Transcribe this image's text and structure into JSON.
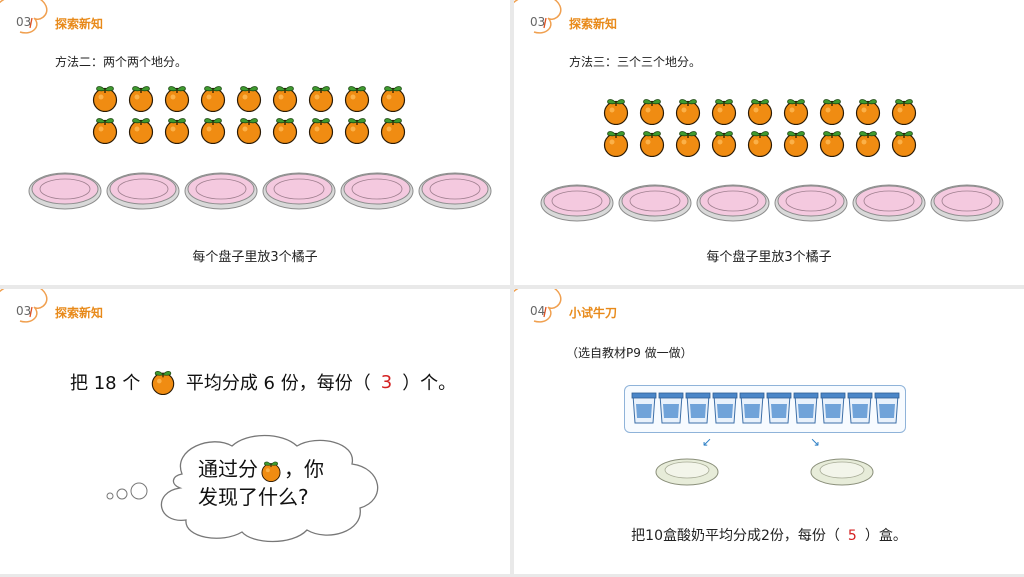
{
  "panels": [
    {
      "num": "03",
      "title": "探索新知",
      "subtitle": "方法二：两个两个地分。",
      "caption": "每个盘子里放3个橘子"
    },
    {
      "num": "03",
      "title": "探索新知",
      "subtitle": "方法三：三个三个地分。",
      "caption": "每个盘子里放3个橘子"
    },
    {
      "num": "03",
      "title": "探索新知",
      "question": {
        "part1": "把 18 个",
        "part2": "平均分成 6 份，每份（",
        "answer": "3",
        "part3": "）个。"
      },
      "cloud": {
        "line1a": "通过分",
        "line1b": "，你",
        "line2": "发现了什么?"
      }
    },
    {
      "num": "04",
      "title": "小试牛刀",
      "subtitle": "（选自教材P9 做一做）",
      "sentence": {
        "part1": "把10盒酸奶平均分成2份，每份（",
        "answer": "5",
        "part2": "）盒。"
      }
    }
  ],
  "colors": {
    "accent": "#e88a1a",
    "orange": "#f08c12",
    "leaf": "#3f9a2f",
    "plate": "#f4c9df",
    "answer": "#d42020"
  },
  "counts": {
    "oranges_per_panel": 18,
    "plates_per_panel": 6,
    "yogurt_cups": 10
  }
}
